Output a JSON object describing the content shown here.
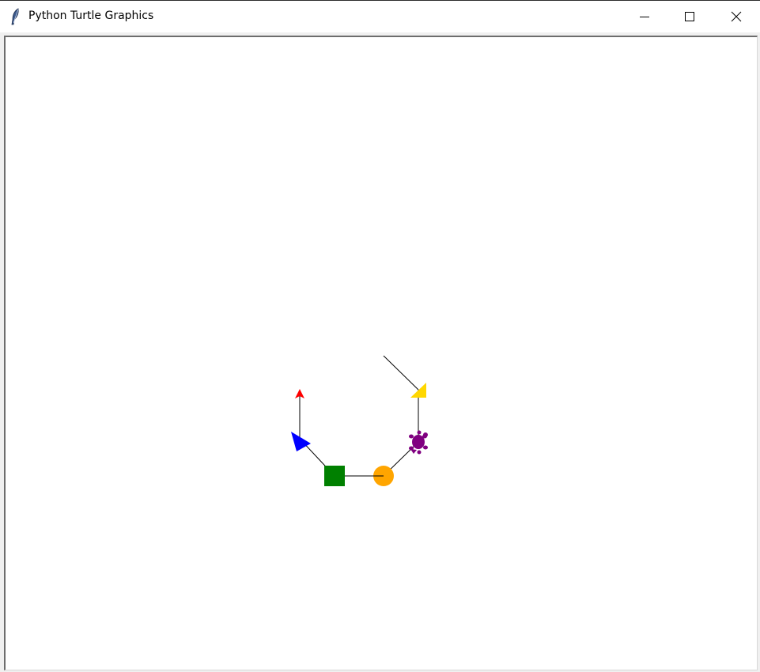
{
  "window": {
    "title": "Python Turtle Graphics",
    "app_icon": "feather-icon",
    "controls": [
      "minimize-icon",
      "maximize-icon",
      "close-icon"
    ]
  },
  "canvas": {
    "background": "#ffffff",
    "turtles": [
      {
        "shape": "arrow",
        "color": "#ff0000"
      },
      {
        "shape": "triangle",
        "color": "#0000ff"
      },
      {
        "shape": "square",
        "color": "#008000"
      },
      {
        "shape": "circle",
        "color": "#ffa500"
      },
      {
        "shape": "turtle",
        "color": "#800080"
      },
      {
        "shape": "classic",
        "color": "#ffd700"
      }
    ],
    "line_color": "#000000"
  }
}
